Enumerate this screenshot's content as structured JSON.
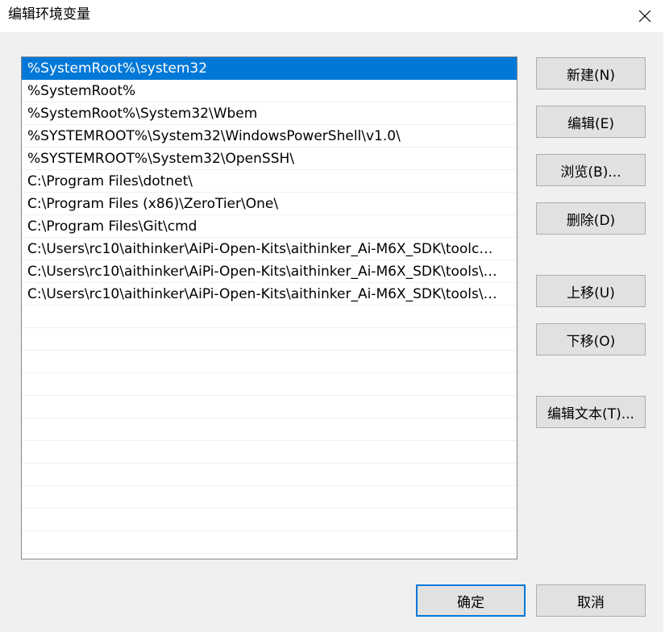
{
  "window": {
    "title": "编辑环境变量",
    "close_icon": "close-icon"
  },
  "path_list": {
    "selected_index": 0,
    "items": [
      "%SystemRoot%\\system32",
      "%SystemRoot%",
      "%SystemRoot%\\System32\\Wbem",
      "%SYSTEMROOT%\\System32\\WindowsPowerShell\\v1.0\\",
      "%SYSTEMROOT%\\System32\\OpenSSH\\",
      "C:\\Program Files\\dotnet\\",
      "C:\\Program Files (x86)\\ZeroTier\\One\\",
      "C:\\Program Files\\Git\\cmd",
      "C:\\Users\\rc10\\aithinker\\AiPi-Open-Kits\\aithinker_Ai-M6X_SDK\\toolc…",
      "C:\\Users\\rc10\\aithinker\\AiPi-Open-Kits\\aithinker_Ai-M6X_SDK\\tools\\…",
      "C:\\Users\\rc10\\aithinker\\AiPi-Open-Kits\\aithinker_Ai-M6X_SDK\\tools\\…",
      "",
      "",
      "",
      "",
      "",
      "",
      "",
      "",
      "",
      "",
      ""
    ]
  },
  "buttons": {
    "new": "新建(N)",
    "edit": "编辑(E)",
    "browse": "浏览(B)...",
    "delete": "删除(D)",
    "move_up": "上移(U)",
    "move_down": "下移(O)",
    "edit_text": "编辑文本(T)...",
    "ok": "确定",
    "cancel": "取消"
  },
  "colors": {
    "selection": "#0078d7",
    "button_face": "#e1e1e1",
    "dialog_bg": "#f0f0f0"
  }
}
